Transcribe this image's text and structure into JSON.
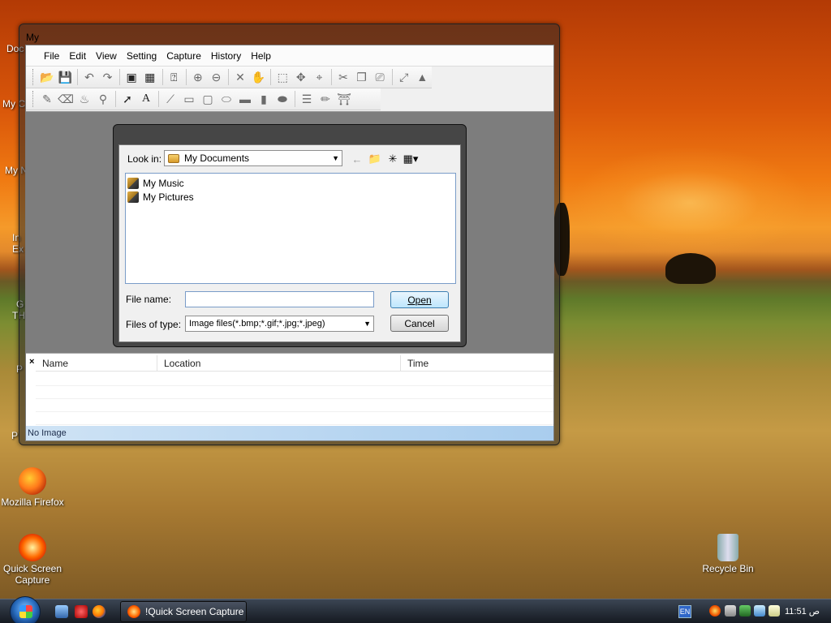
{
  "window": {
    "title": "My",
    "menu": [
      {
        "label": "File"
      },
      {
        "label": "Edit"
      },
      {
        "label": "View"
      },
      {
        "label": "Setting"
      },
      {
        "label": "Capture"
      },
      {
        "label": "History"
      },
      {
        "label": "Help"
      }
    ],
    "status": "No Image"
  },
  "dialog": {
    "look_in_label": "Look in:",
    "look_in_value": "My Documents",
    "items": [
      {
        "name": "My Music"
      },
      {
        "name": "My Pictures"
      }
    ],
    "file_name_label": "File name:",
    "file_name_value": "",
    "file_type_label": "Files of type:",
    "file_type_value": "Image files(*.bmp;*.gif;*.jpg;*.jpeg)",
    "open_label": "Open",
    "cancel_label": "Cancel"
  },
  "history": {
    "close": "×",
    "columns": [
      "Name",
      "Location",
      "Time"
    ]
  },
  "desktop": {
    "icons": [
      {
        "label": "Mozilla Firefox"
      },
      {
        "label": "Quick Screen Capture"
      },
      {
        "label": "Recycle Bin"
      }
    ],
    "left_fragments": [
      "Doc",
      "My C",
      "My N",
      "In",
      "Ex",
      "G",
      "TH",
      "P",
      "P"
    ]
  },
  "taskbar": {
    "active_task": "!Quick Screen Capture",
    "language": "EN",
    "clock": "11:51 ص"
  },
  "colors": {
    "accent": "#3c7fb1",
    "status_bar": "#a9cdee",
    "work_area": "#7d7d7d"
  }
}
